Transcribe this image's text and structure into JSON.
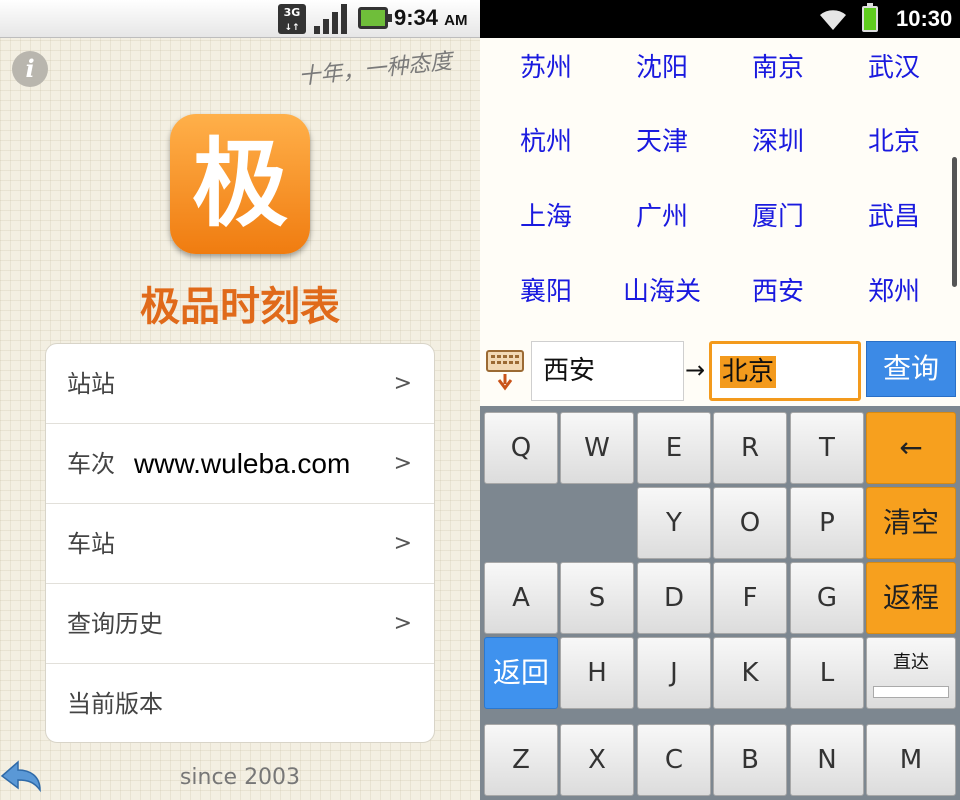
{
  "left": {
    "status_bar": {
      "network": "3G",
      "time": "9:34",
      "ampm": "AM"
    },
    "info_icon": "i",
    "slogan": "十年，一种态度",
    "logo_char": "极",
    "app_title": "极品时刻表",
    "menu": [
      {
        "label": "站站",
        "chevron": ">"
      },
      {
        "label": "车次",
        "chevron": ">",
        "overlay": "www.wuleba.com"
      },
      {
        "label": "车站",
        "chevron": ">"
      },
      {
        "label": "查询历史",
        "chevron": ">"
      },
      {
        "label": "当前版本",
        "chevron": ""
      }
    ],
    "since": "since 2003"
  },
  "right": {
    "status_bar": {
      "time": "10:30"
    },
    "cities": [
      [
        "苏州",
        "沈阳",
        "南京",
        "武汉"
      ],
      [
        "杭州",
        "天津",
        "深圳",
        "北京"
      ],
      [
        "上海",
        "广州",
        "厦门",
        "武昌"
      ],
      [
        "襄阳",
        "山海关",
        "西安",
        "郑州"
      ]
    ],
    "search": {
      "from": "西安",
      "arrow": "→",
      "to": "北京",
      "query_label": "查询"
    },
    "keyboard": {
      "row1": [
        "Q",
        "W",
        "E",
        "R",
        "T"
      ],
      "backspace": "←",
      "row2": [
        "Y",
        "O",
        "P"
      ],
      "clear": "清空",
      "row3": [
        "A",
        "S",
        "D",
        "F",
        "G"
      ],
      "return_trip": "返程",
      "back": "返回",
      "row4": [
        "H",
        "J",
        "K",
        "L"
      ],
      "direct": "直达",
      "row5": [
        "Z",
        "X",
        "C",
        "B",
        "N",
        "M"
      ]
    }
  },
  "colors": {
    "accent_orange": "#f39a1d",
    "accent_blue": "#3c8ae6",
    "city_blue": "#1a1adf",
    "title_orange": "#e06a1a"
  }
}
